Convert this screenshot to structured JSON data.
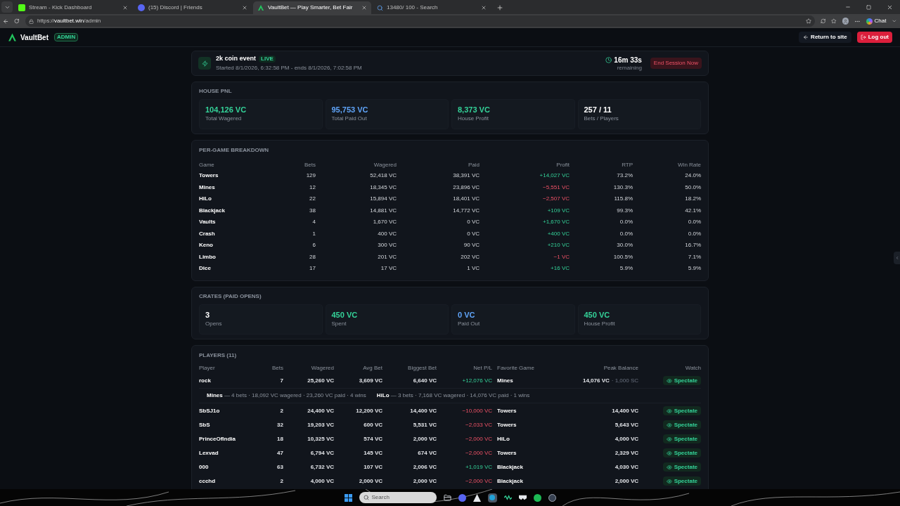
{
  "browser": {
    "tabs": [
      {
        "title": "Stream - Kick Dashboard",
        "kind": "kick",
        "selected": false
      },
      {
        "title": "(15) Discord | Friends",
        "kind": "discord",
        "selected": false
      },
      {
        "title": "VaultBet — Play Smarter, Bet Fair",
        "kind": "vault",
        "selected": true
      },
      {
        "title": "13480/ 100 - Search",
        "kind": "search",
        "selected": false
      }
    ],
    "url_prefix": "https://",
    "url_host": "vaultbet.win",
    "url_path": "/admin",
    "chat_label": "Chat"
  },
  "header": {
    "brand": "VaultBet",
    "badge": "ADMIN",
    "return_label": "Return to site",
    "logout_label": "Log out"
  },
  "event": {
    "name": "2k coin event",
    "status": "LIVE",
    "subtitle": "Started 8/1/2026, 6:32:58 PM - ends 8/1/2026, 7:02:58 PM",
    "timer": "16m 33s",
    "timer_caption": "remaining",
    "end_label": "End Session Now"
  },
  "house_pnl": {
    "title": "HOUSE PNL",
    "stats": [
      {
        "value": "104,126 VC",
        "label": "Total Wagered",
        "color": "#34d399"
      },
      {
        "value": "95,753 VC",
        "label": "Total Paid Out",
        "color": "#60a5fa"
      },
      {
        "value": "8,373 VC",
        "label": "House Profit",
        "color": "#34d399"
      },
      {
        "value": "257 / 11",
        "label": "Bets / Players",
        "color": "#ffffff"
      }
    ]
  },
  "breakdown": {
    "title": "PER-GAME BREAKDOWN",
    "columns": [
      "Game",
      "Bets",
      "Wagered",
      "Paid",
      "Profit",
      "RTP",
      "Win Rate"
    ],
    "rows": [
      {
        "game": "Towers",
        "bets": "129",
        "wagered": "52,418 VC",
        "paid": "38,391 VC",
        "profit": "+14,027 VC",
        "positive": true,
        "rtp": "73.2%",
        "win_rate": "24.0%"
      },
      {
        "game": "Mines",
        "bets": "12",
        "wagered": "18,345 VC",
        "paid": "23,896 VC",
        "profit": "−5,551 VC",
        "positive": false,
        "rtp": "130.3%",
        "win_rate": "50.0%"
      },
      {
        "game": "HiLo",
        "bets": "22",
        "wagered": "15,894 VC",
        "paid": "18,401 VC",
        "profit": "−2,507 VC",
        "positive": false,
        "rtp": "115.8%",
        "win_rate": "18.2%"
      },
      {
        "game": "Blackjack",
        "bets": "38",
        "wagered": "14,881 VC",
        "paid": "14,772 VC",
        "profit": "+109 VC",
        "positive": true,
        "rtp": "99.3%",
        "win_rate": "42.1%"
      },
      {
        "game": "Vaults",
        "bets": "4",
        "wagered": "1,670 VC",
        "paid": "0 VC",
        "profit": "+1,670 VC",
        "positive": true,
        "rtp": "0.0%",
        "win_rate": "0.0%"
      },
      {
        "game": "Crash",
        "bets": "1",
        "wagered": "400 VC",
        "paid": "0 VC",
        "profit": "+400 VC",
        "positive": true,
        "rtp": "0.0%",
        "win_rate": "0.0%"
      },
      {
        "game": "Keno",
        "bets": "6",
        "wagered": "300 VC",
        "paid": "90 VC",
        "profit": "+210 VC",
        "positive": true,
        "rtp": "30.0%",
        "win_rate": "16.7%"
      },
      {
        "game": "Limbo",
        "bets": "28",
        "wagered": "201 VC",
        "paid": "202 VC",
        "profit": "−1 VC",
        "positive": false,
        "rtp": "100.5%",
        "win_rate": "7.1%"
      },
      {
        "game": "Dice",
        "bets": "17",
        "wagered": "17 VC",
        "paid": "1 VC",
        "profit": "+16 VC",
        "positive": true,
        "rtp": "5.9%",
        "win_rate": "5.9%"
      }
    ]
  },
  "crates": {
    "title": "CRATES (PAID OPENS)",
    "stats": [
      {
        "value": "3",
        "label": "Opens",
        "color": "#ffffff"
      },
      {
        "value": "450 VC",
        "label": "Spent",
        "color": "#34d399"
      },
      {
        "value": "0 VC",
        "label": "Paid Out",
        "color": "#60a5fa"
      },
      {
        "value": "450 VC",
        "label": "House Profit",
        "color": "#34d399"
      }
    ]
  },
  "players": {
    "title": "PLAYERS (11)",
    "columns": [
      "Player",
      "Bets",
      "Wagered",
      "Avg Bet",
      "Biggest Bet",
      "Net P/L",
      "Favorite Game",
      "Peak Balance",
      "Watch"
    ],
    "rows": [
      {
        "player": "rock",
        "bets": "7",
        "wagered": "25,260 VC",
        "avg_bet": "3,609 VC",
        "biggest_bet": "6,640 VC",
        "net": "+12,076 VC",
        "positive": true,
        "favorite": "Mines",
        "peak": "14,076 VC",
        "peak_extra": "· 1,000 SC",
        "watch": "Spectate",
        "details": [
          "**Mines** — 4 bets · 18,092 VC wagered · 23,260 VC paid · 4 wins",
          "**HiLo** — 3 bets · 7,168 VC wagered · 14,076 VC paid · 1 wins"
        ]
      },
      {
        "player": "SbSJ1o",
        "bets": "2",
        "wagered": "24,400 VC",
        "avg_bet": "12,200 VC",
        "biggest_bet": "14,400 VC",
        "net": "−10,000 VC",
        "positive": false,
        "favorite": "Towers",
        "peak": "14,400 VC",
        "watch": "Spectate"
      },
      {
        "player": "SbS",
        "bets": "32",
        "wagered": "19,203 VC",
        "avg_bet": "600 VC",
        "biggest_bet": "5,531 VC",
        "net": "−2,033 VC",
        "positive": false,
        "favorite": "Towers",
        "peak": "5,643 VC",
        "watch": "Spectate"
      },
      {
        "player": "PrinceOfIndia",
        "bets": "18",
        "wagered": "10,325 VC",
        "avg_bet": "574 VC",
        "biggest_bet": "2,000 VC",
        "net": "−2,000 VC",
        "positive": false,
        "favorite": "HiLo",
        "peak": "4,000 VC",
        "watch": "Spectate"
      },
      {
        "player": "Lexvad",
        "bets": "47",
        "wagered": "6,794 VC",
        "avg_bet": "145 VC",
        "biggest_bet": "674 VC",
        "net": "−2,000 VC",
        "positive": false,
        "favorite": "Towers",
        "peak": "2,329 VC",
        "watch": "Spectate"
      },
      {
        "player": "000",
        "bets": "63",
        "wagered": "6,732 VC",
        "avg_bet": "107 VC",
        "biggest_bet": "2,006 VC",
        "net": "+1,019 VC",
        "positive": true,
        "favorite": "Blackjack",
        "peak": "4,030 VC",
        "watch": "Spectate"
      },
      {
        "player": "ccchd",
        "bets": "2",
        "wagered": "4,000 VC",
        "avg_bet": "2,000 VC",
        "biggest_bet": "2,000 VC",
        "net": "−2,000 VC",
        "positive": false,
        "favorite": "Blackjack",
        "peak": "2,000 VC",
        "watch": "Spectate"
      }
    ]
  },
  "taskbar": {
    "search_placeholder": "Search"
  }
}
